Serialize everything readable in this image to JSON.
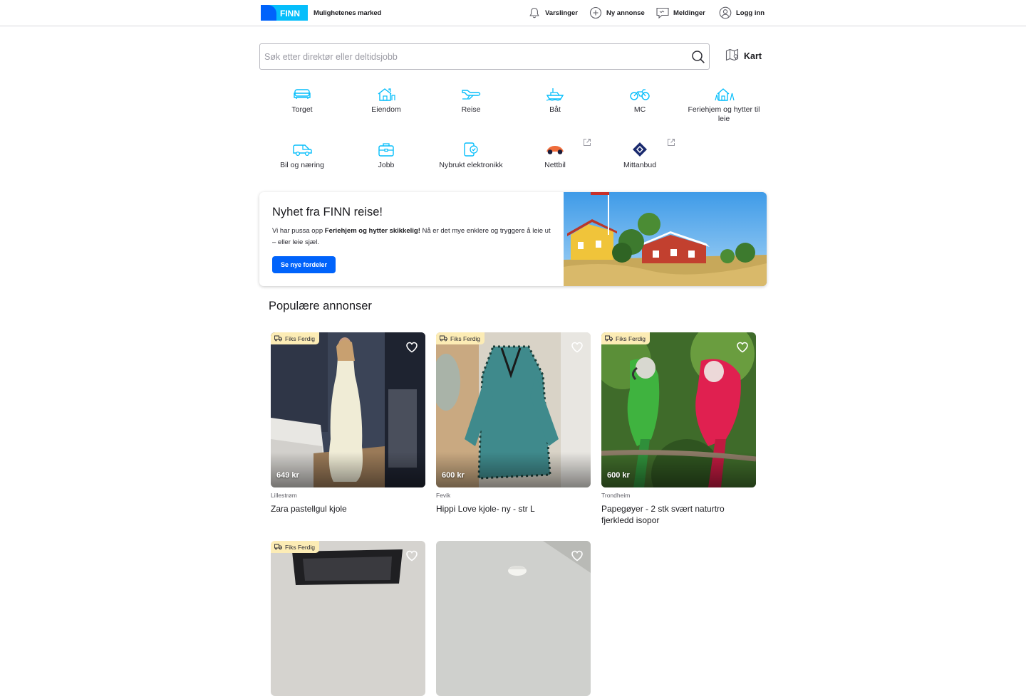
{
  "header": {
    "brand": "FINN",
    "tagline": "Mulighetenes marked",
    "nav": [
      {
        "label": "Varslinger",
        "icon": "bell-icon"
      },
      {
        "label": "Ny annonse",
        "icon": "plus-circle-icon"
      },
      {
        "label": "Meldinger",
        "icon": "chat-icon"
      },
      {
        "label": "Logg inn",
        "icon": "user-circle-icon"
      }
    ]
  },
  "search": {
    "placeholder": "Søk etter direktør eller deltidsjobb",
    "value": "",
    "map_label": "Kart"
  },
  "categories": [
    {
      "label": "Torget",
      "icon": "sofa-icon"
    },
    {
      "label": "Eiendom",
      "icon": "house-icon"
    },
    {
      "label": "Reise",
      "icon": "airplane-icon"
    },
    {
      "label": "Båt",
      "icon": "boat-icon"
    },
    {
      "label": "MC",
      "icon": "motorcycle-icon"
    },
    {
      "label": "Feriehjem og hytter til leie",
      "icon": "cabin-icon"
    },
    {
      "label": "Bil og næring",
      "icon": "van-icon"
    },
    {
      "label": "Jobb",
      "icon": "briefcase-icon"
    },
    {
      "label": "Nybrukt elektronikk",
      "icon": "tablet-check-icon"
    },
    {
      "label": "Nettbil",
      "icon": "nettbil-logo-icon"
    },
    {
      "label": "Mittanbud",
      "icon": "mittanbud-logo-icon"
    }
  ],
  "banner": {
    "title": "Nyhet fra FINN reise!",
    "text_prefix": "Vi har pussa opp ",
    "text_bold": "Feriehjem og hytter skikkelig!",
    "text_suffix": " Nå er det mye enklere og tryggere å leie ut – eller leie sjæl.",
    "button": "Se nye fordeler"
  },
  "popular": {
    "title": "Populære annonser",
    "items": [
      {
        "badge": "Fiks Ferdig",
        "price": "649 kr",
        "location": "Lillestrøm",
        "title": "Zara pastellgul kjole"
      },
      {
        "badge": "Fiks Ferdig",
        "price": "600 kr",
        "location": "Fevik",
        "title": "Hippi Love kjole- ny - str L"
      },
      {
        "badge": "Fiks Ferdig",
        "price": "600 kr",
        "location": "Trondheim",
        "title": "Papegøyer - 2 stk svært naturtro fjerkledd isopor"
      },
      {
        "badge": "Fiks Ferdig"
      },
      {
        "badge": ""
      }
    ]
  },
  "colors": {
    "brand_blue": "#0063fb",
    "brand_light_blue": "#06befb",
    "icon_blue": "#06befb",
    "badge_bg": "#fcecb5"
  }
}
